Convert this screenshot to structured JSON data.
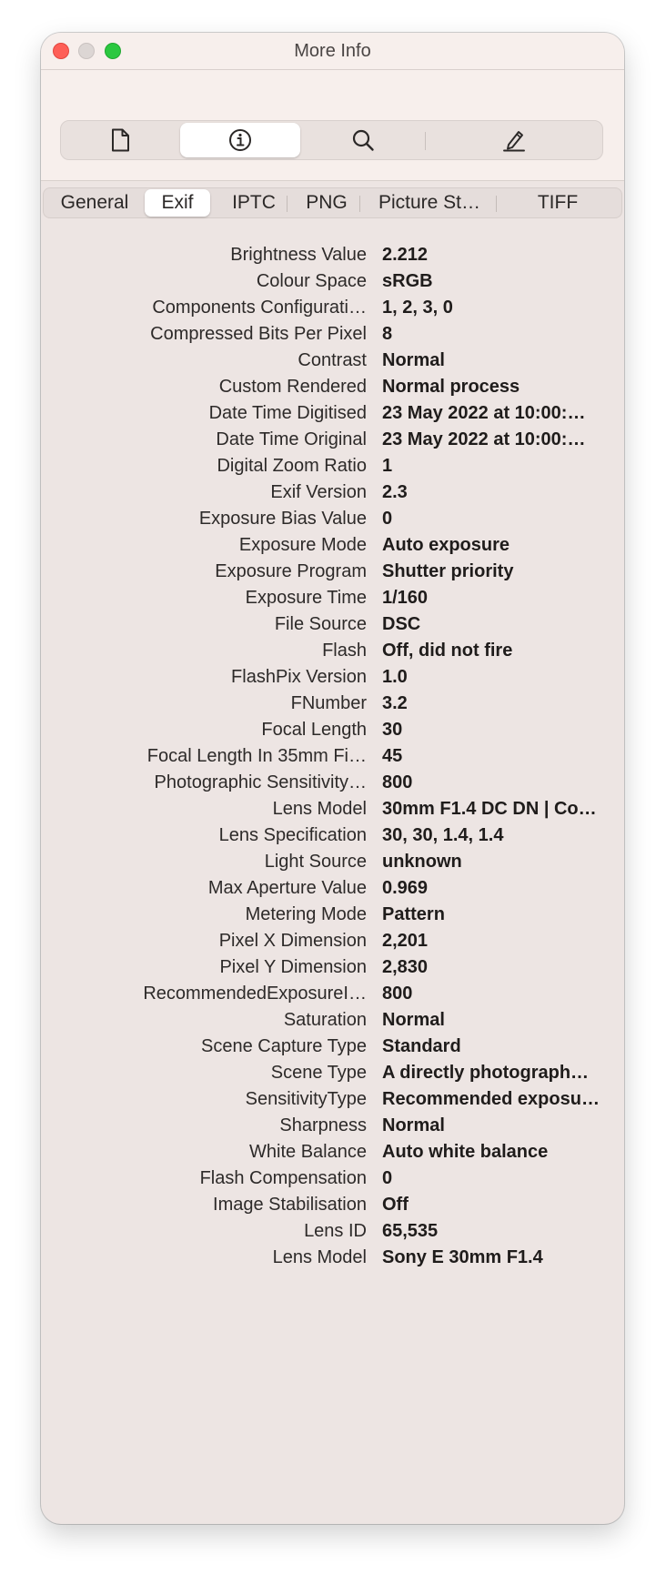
{
  "window": {
    "title": "More Info"
  },
  "toolbar": {
    "buttons": [
      {
        "icon": "document-icon",
        "active": false
      },
      {
        "icon": "info-icon",
        "active": true
      },
      {
        "icon": "magnifier-icon",
        "active": false
      },
      {
        "icon": "pencil-icon",
        "active": false
      }
    ]
  },
  "tabs": [
    {
      "label": "General",
      "active": false
    },
    {
      "label": "Exif",
      "active": true
    },
    {
      "label": "IPTC",
      "active": false
    },
    {
      "label": "PNG",
      "active": false
    },
    {
      "label": "Picture St…",
      "active": false
    },
    {
      "label": "TIFF",
      "active": false
    }
  ],
  "rows": [
    {
      "label": "Brightness Value",
      "value": "2.212"
    },
    {
      "label": "Colour Space",
      "value": "sRGB"
    },
    {
      "label": "Components Configurati…",
      "value": "1, 2, 3, 0"
    },
    {
      "label": "Compressed Bits Per Pixel",
      "value": "8"
    },
    {
      "label": "Contrast",
      "value": "Normal"
    },
    {
      "label": "Custom Rendered",
      "value": "Normal process"
    },
    {
      "label": "Date Time Digitised",
      "value": "23 May 2022 at 10:00:…"
    },
    {
      "label": "Date Time Original",
      "value": "23 May 2022 at 10:00:…"
    },
    {
      "label": "Digital Zoom Ratio",
      "value": "1"
    },
    {
      "label": "Exif Version",
      "value": "2.3"
    },
    {
      "label": "Exposure Bias Value",
      "value": "0"
    },
    {
      "label": "Exposure Mode",
      "value": "Auto exposure"
    },
    {
      "label": "Exposure Program",
      "value": "Shutter priority"
    },
    {
      "label": "Exposure Time",
      "value": "1/160"
    },
    {
      "label": "File Source",
      "value": "DSC"
    },
    {
      "label": "Flash",
      "value": "Off, did not fire"
    },
    {
      "label": "FlashPix Version",
      "value": "1.0"
    },
    {
      "label": "FNumber",
      "value": "3.2"
    },
    {
      "label": "Focal Length",
      "value": "30"
    },
    {
      "label": "Focal Length In 35mm Fi…",
      "value": "45"
    },
    {
      "label": "Photographic Sensitivity…",
      "value": "800"
    },
    {
      "label": "Lens Model",
      "value": "30mm F1.4 DC DN | Co…"
    },
    {
      "label": "Lens Specification",
      "value": "30, 30, 1.4, 1.4"
    },
    {
      "label": "Light Source",
      "value": "unknown"
    },
    {
      "label": "Max Aperture Value",
      "value": "0.969"
    },
    {
      "label": "Metering Mode",
      "value": "Pattern"
    },
    {
      "label": "Pixel X Dimension",
      "value": "2,201"
    },
    {
      "label": "Pixel Y Dimension",
      "value": "2,830"
    },
    {
      "label": "RecommendedExposureI…",
      "value": "800"
    },
    {
      "label": "Saturation",
      "value": "Normal"
    },
    {
      "label": "Scene Capture Type",
      "value": "Standard"
    },
    {
      "label": "Scene Type",
      "value": "A directly photograph…"
    },
    {
      "label": "SensitivityType",
      "value": "Recommended exposu…"
    },
    {
      "label": "Sharpness",
      "value": "Normal"
    },
    {
      "label": "White Balance",
      "value": "Auto white balance"
    },
    {
      "label": "Flash Compensation",
      "value": "0"
    },
    {
      "label": "Image Stabilisation",
      "value": "Off"
    },
    {
      "label": "Lens ID",
      "value": "65,535"
    },
    {
      "label": "Lens Model",
      "value": "Sony E 30mm F1.4"
    }
  ]
}
